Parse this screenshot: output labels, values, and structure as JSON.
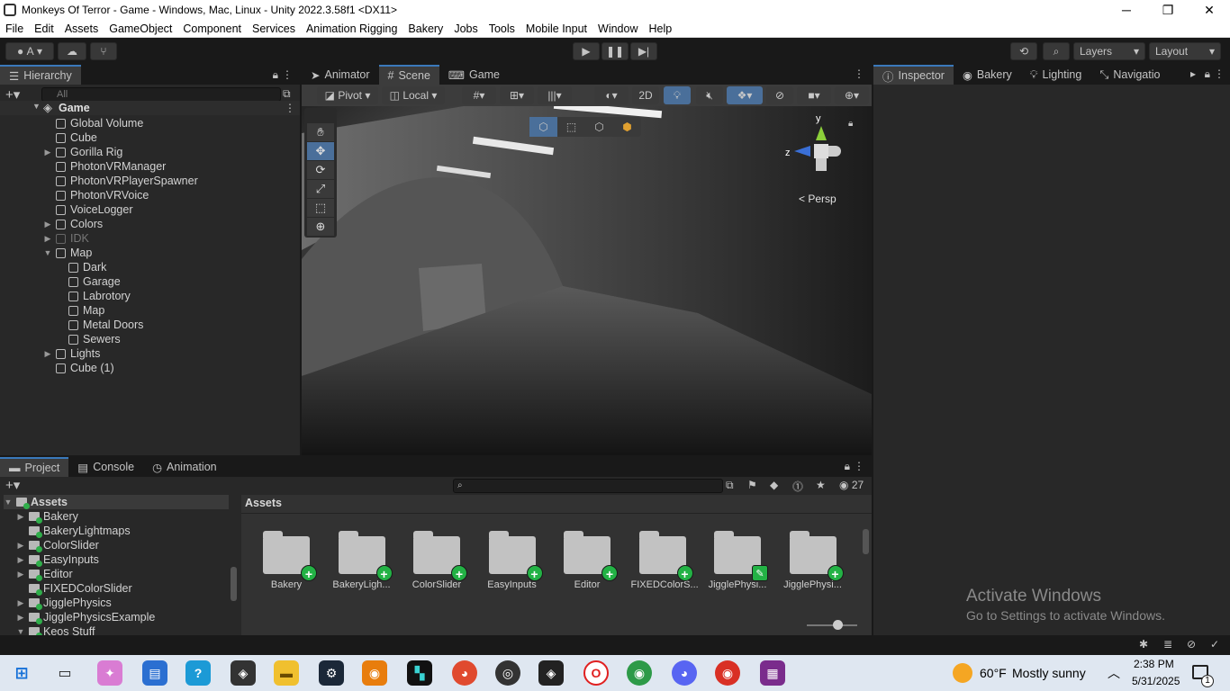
{
  "window": {
    "title": "Monkeys Of Terror - Game - Windows, Mac, Linux - Unity 2022.3.58f1 <DX11>",
    "minimize": "─",
    "maximize": "❐",
    "close": "✕"
  },
  "menu": [
    "File",
    "Edit",
    "Assets",
    "GameObject",
    "Component",
    "Services",
    "Animation Rigging",
    "Bakery",
    "Jobs",
    "Tools",
    "Mobile Input",
    "Window",
    "Help"
  ],
  "toolbar": {
    "account": "A",
    "layers_label": "Layers",
    "layout_label": "Layout"
  },
  "hierarchy": {
    "tab_label": "Hierarchy",
    "search_placeholder": "All",
    "scene_name": "Game",
    "items": [
      {
        "label": "Global Volume",
        "indent": 1,
        "arrow": ""
      },
      {
        "label": "Cube",
        "indent": 1,
        "arrow": ""
      },
      {
        "label": "Gorilla Rig",
        "indent": 1,
        "arrow": "▶"
      },
      {
        "label": "PhotonVRManager",
        "indent": 1,
        "arrow": ""
      },
      {
        "label": "PhotonVRPlayerSpawner",
        "indent": 1,
        "arrow": ""
      },
      {
        "label": "PhotonVRVoice",
        "indent": 1,
        "arrow": ""
      },
      {
        "label": "VoiceLogger",
        "indent": 1,
        "arrow": ""
      },
      {
        "label": "Colors",
        "indent": 1,
        "arrow": "▶"
      },
      {
        "label": "IDK",
        "indent": 1,
        "arrow": "▶",
        "dim": true
      },
      {
        "label": "Map",
        "indent": 1,
        "arrow": "▼"
      },
      {
        "label": "Dark",
        "indent": 2,
        "arrow": ""
      },
      {
        "label": "Garage",
        "indent": 2,
        "arrow": ""
      },
      {
        "label": "Labrotory",
        "indent": 2,
        "arrow": ""
      },
      {
        "label": "Map",
        "indent": 2,
        "arrow": ""
      },
      {
        "label": "Metal Doors",
        "indent": 2,
        "arrow": ""
      },
      {
        "label": "Sewers",
        "indent": 2,
        "arrow": ""
      },
      {
        "label": "Lights",
        "indent": 1,
        "arrow": "▶"
      },
      {
        "label": "Cube (1)",
        "indent": 1,
        "arrow": ""
      }
    ]
  },
  "scene_tabs": [
    {
      "label": "Animator",
      "active": false
    },
    {
      "label": "Scene",
      "active": true
    },
    {
      "label": "Game",
      "active": false
    }
  ],
  "scene_toolbar": {
    "pivot": "Pivot",
    "local": "Local",
    "mode_2d": "2D"
  },
  "gizmo": {
    "y": "y",
    "z": "z",
    "persp": "Persp"
  },
  "inspector_tabs": [
    "Inspector",
    "Bakery",
    "Lighting",
    "Navigatio"
  ],
  "project": {
    "tabs": [
      "Project",
      "Console",
      "Animation"
    ],
    "hidden_count": "27",
    "root": "Assets",
    "breadcrumb": "Assets",
    "tree": [
      "Bakery",
      "BakeryLightmaps",
      "ColorSlider",
      "EasyInputs",
      "Editor",
      "FIXEDColorSlider",
      "JigglePhysics",
      "JigglePhysicsExample",
      "Keos Stuff"
    ],
    "assets": [
      {
        "label": "Bakery",
        "badge": "+"
      },
      {
        "label": "BakeryLigh...",
        "badge": "+"
      },
      {
        "label": "ColorSlider",
        "badge": "+"
      },
      {
        "label": "EasyInputs",
        "badge": "+"
      },
      {
        "label": "Editor",
        "badge": "+"
      },
      {
        "label": "FIXEDColorS...",
        "badge": "+"
      },
      {
        "label": "JigglePhysi...",
        "badge": "✎"
      },
      {
        "label": "JigglePhysi...",
        "badge": "+"
      }
    ]
  },
  "watermark": {
    "line1": "Activate Windows",
    "line2": "Go to Settings to activate Windows."
  },
  "taskbar": {
    "weather_temp": "60°F",
    "weather_desc": "Mostly sunny",
    "time": "2:38 PM",
    "date": "5/31/2025",
    "notification_count": "1"
  },
  "colors": {
    "accent": "#3a79bb",
    "panel": "#282828",
    "badge_green": "#23b245"
  }
}
